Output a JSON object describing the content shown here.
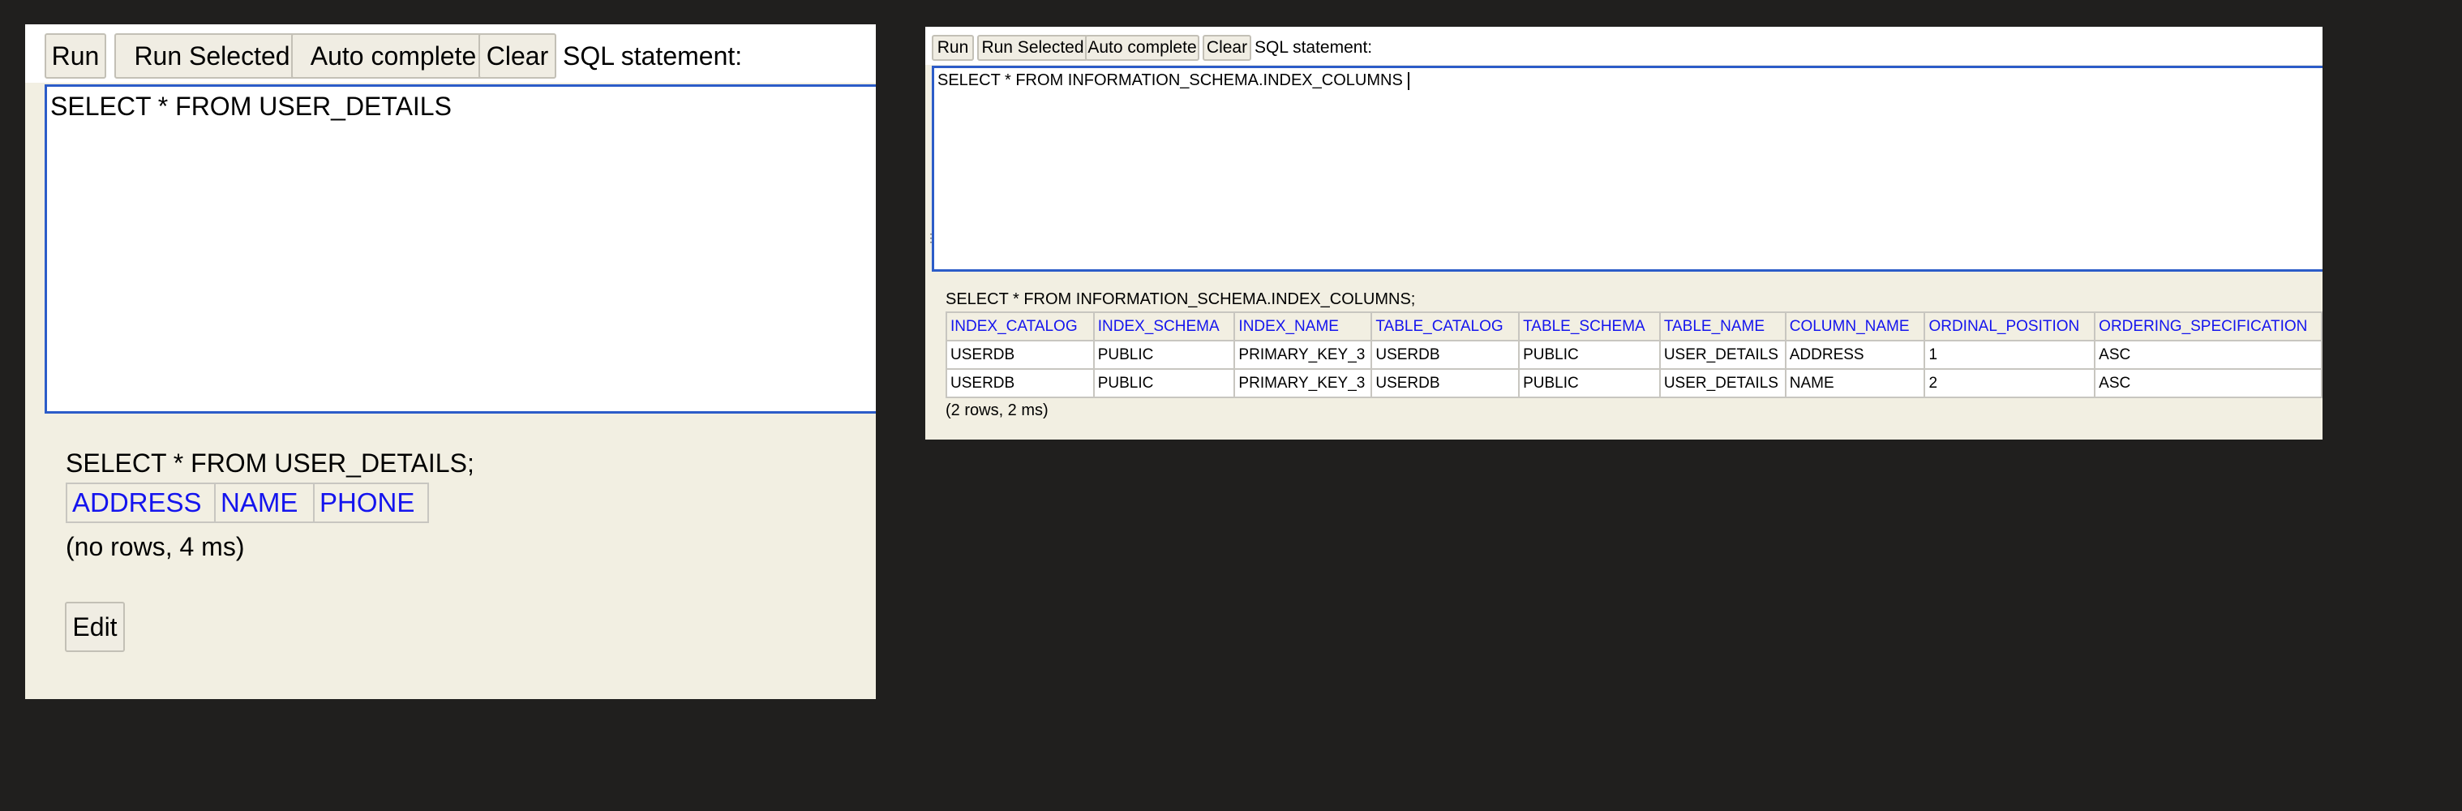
{
  "left_panel": {
    "toolbar": {
      "run_label": "Run",
      "run_selected_label": "Run Selected",
      "auto_complete_label": "Auto complete",
      "clear_label": "Clear",
      "sql_label": "SQL statement:"
    },
    "editor_text": "SELECT * FROM USER_DETAILS",
    "result": {
      "statement": "SELECT * FROM USER_DETAILS;",
      "columns": [
        "ADDRESS",
        "NAME",
        "PHONE"
      ],
      "summary": "(no rows, 4 ms)",
      "edit_label": "Edit"
    }
  },
  "right_panel": {
    "toolbar": {
      "run_label": "Run",
      "run_selected_label": "Run Selected",
      "auto_complete_label": "Auto complete",
      "clear_label": "Clear",
      "sql_label": "SQL statement:"
    },
    "editor_text": "SELECT * FROM INFORMATION_SCHEMA.INDEX_COLUMNS",
    "result": {
      "statement": "SELECT * FROM INFORMATION_SCHEMA.INDEX_COLUMNS;",
      "columns": [
        "INDEX_CATALOG",
        "INDEX_SCHEMA",
        "INDEX_NAME",
        "TABLE_CATALOG",
        "TABLE_SCHEMA",
        "TABLE_NAME",
        "COLUMN_NAME",
        "ORDINAL_POSITION",
        "ORDERING_SPECIFICATION"
      ],
      "rows": [
        [
          "USERDB",
          "PUBLIC",
          "PRIMARY_KEY_3",
          "USERDB",
          "PUBLIC",
          "USER_DETAILS",
          "ADDRESS",
          "1",
          "ASC"
        ],
        [
          "USERDB",
          "PUBLIC",
          "PRIMARY_KEY_3",
          "USERDB",
          "PUBLIC",
          "USER_DETAILS",
          "NAME",
          "2",
          "ASC"
        ]
      ],
      "summary": "(2 rows, 2 ms)"
    }
  },
  "colors": {
    "background": "#201f1e",
    "results_panel": "#f2efe2",
    "button_face": "#f0ede3",
    "editor_border": "#2c5cc8",
    "column_header_text": "#1414ee"
  }
}
